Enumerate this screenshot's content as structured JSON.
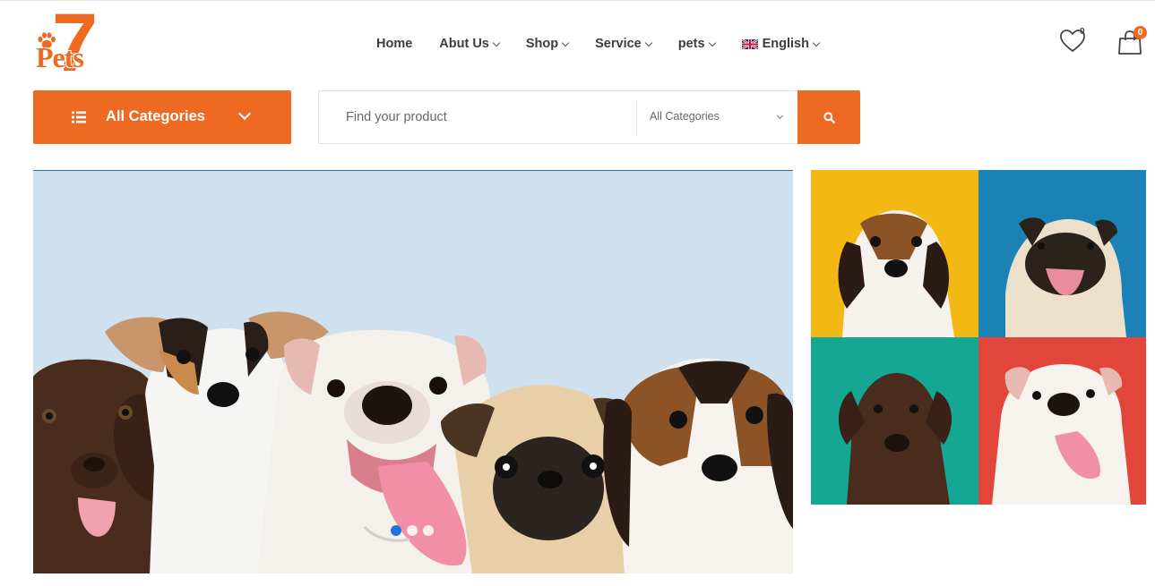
{
  "brand": {
    "logo_number": "7",
    "logo_word": "Pets"
  },
  "nav": {
    "items": [
      {
        "label": "Home",
        "dropdown": false
      },
      {
        "label": "Abut Us",
        "dropdown": true
      },
      {
        "label": "Shop",
        "dropdown": true
      },
      {
        "label": "Service",
        "dropdown": true
      },
      {
        "label": "pets",
        "dropdown": true
      }
    ],
    "language": {
      "label": "English",
      "flag": "uk-flag-icon"
    }
  },
  "header_actions": {
    "wishlist_count": "0",
    "cart_count": "0"
  },
  "category_button": {
    "label": "All Categories",
    "icon": "list-icon"
  },
  "search": {
    "placeholder": "Find your product",
    "category_select": "All Categories",
    "button_icon": "search-icon"
  },
  "slider": {
    "slide_count": 3,
    "active_index": 0
  },
  "colors": {
    "accent": "#ee6a23",
    "hero_background": "#cfe1ef",
    "tile_yellow": "#f4b814",
    "tile_blue": "#1a82b5",
    "tile_teal": "#14a894",
    "tile_red": "#e2463a",
    "active_dot": "#1e74d9"
  }
}
